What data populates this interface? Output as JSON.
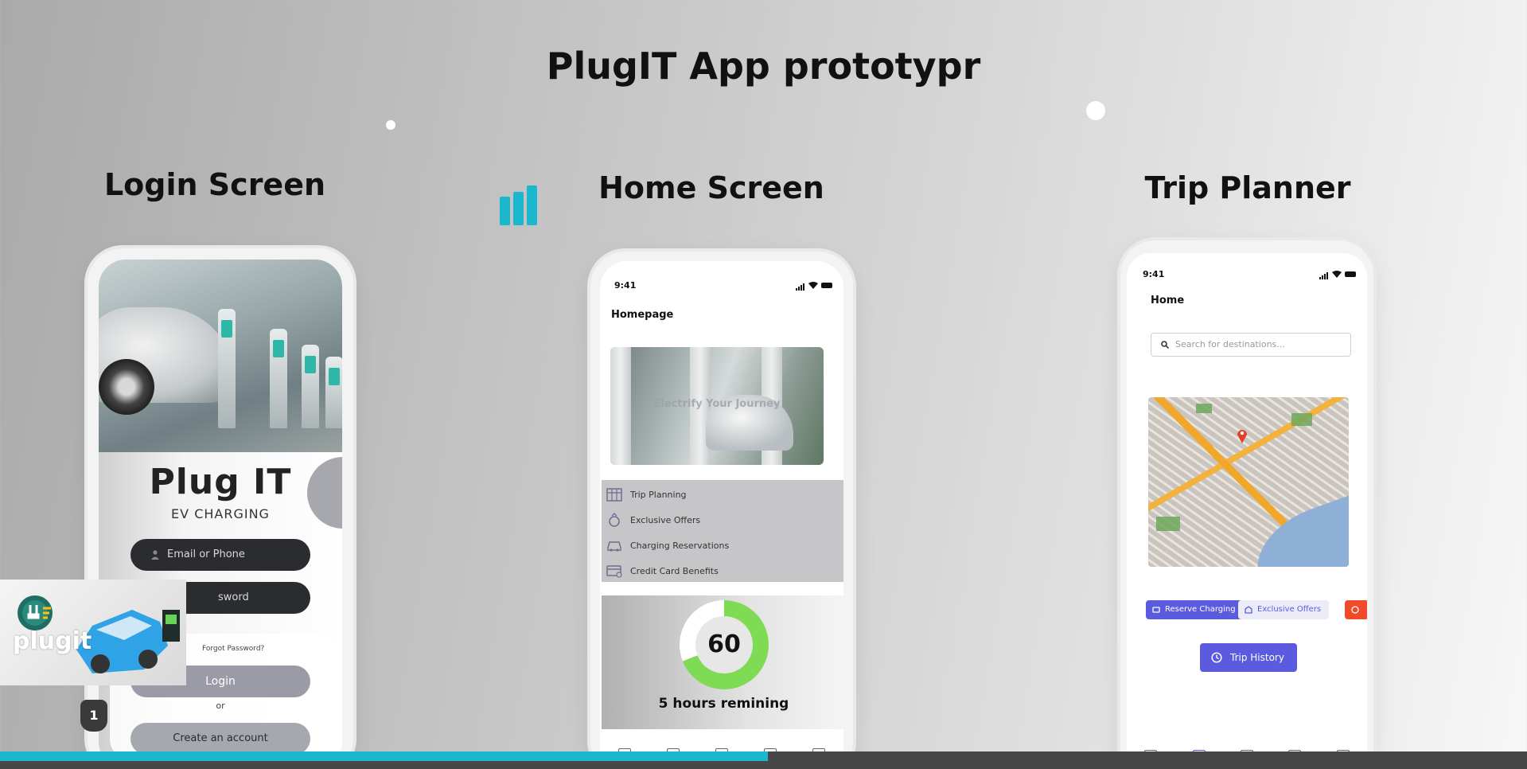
{
  "slide": {
    "title": "PlugIT App prototypr",
    "page_number": "1",
    "progress": 0.503
  },
  "login": {
    "section_title": "Login Screen",
    "brand": "Plug IT",
    "brand_sub": "EV CHARGING",
    "email_placeholder": "Email or Phone",
    "password_placeholder": "sword",
    "forgot": "Forgot Password?",
    "login_label": "Login",
    "or_label": "or",
    "create_label": "Create an account"
  },
  "home": {
    "section_title": "Home Screen",
    "time": "9:41",
    "heading": "Homepage",
    "hero_overlay": "Electrify Your Journey",
    "menu": [
      {
        "label": "Trip Planning",
        "icon": "calendar-grid-icon"
      },
      {
        "label": "Exclusive Offers",
        "icon": "ring-icon"
      },
      {
        "label": "Charging Reservations",
        "icon": "car-icon"
      },
      {
        "label": "Credit Card Benefits",
        "icon": "credit-card-icon"
      }
    ],
    "timer_value": "60",
    "timer_caption": "5 hours remining",
    "timer_fraction": 0.69
  },
  "trip": {
    "section_title": "Trip Planner",
    "time": "9:41",
    "heading": "Home",
    "search_placeholder": "Search for destinations...",
    "chip_reserve": "Reserve Charging",
    "chip_offers": "Exclusive Offers",
    "history_label": "Trip History"
  },
  "logo": {
    "wordmark": "plugit"
  },
  "colors": {
    "accent_cyan": "#1ab8cf",
    "indigo": "#5b5be0",
    "ring_green": "#7fda54"
  }
}
